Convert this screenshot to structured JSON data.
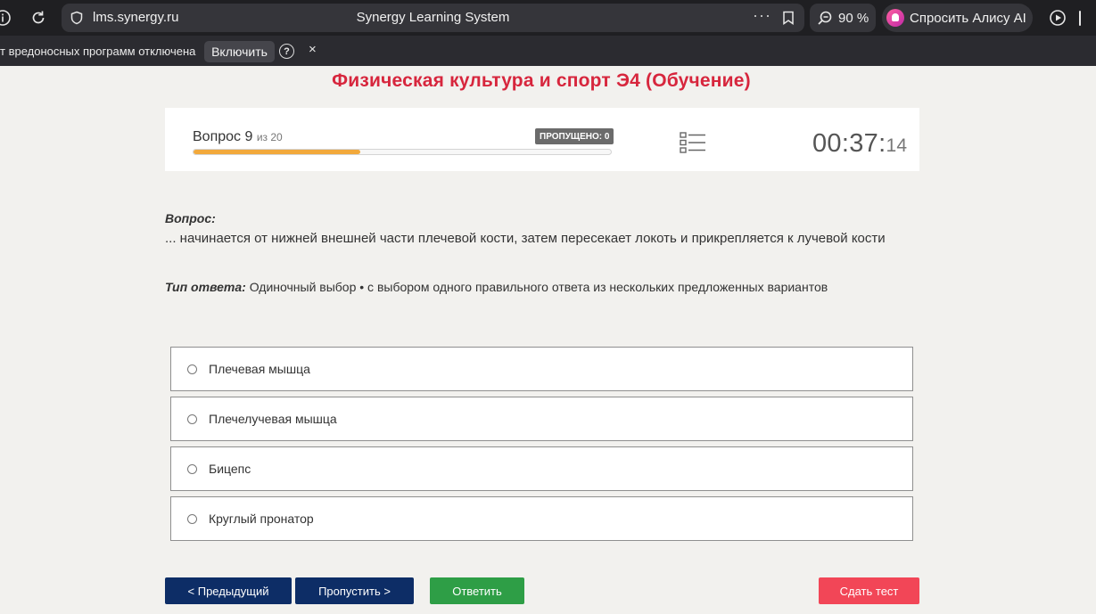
{
  "browser": {
    "url": "lms.synergy.ru",
    "page_title": "Synergy Learning System",
    "menu_dots": "···",
    "zoom": "90 %",
    "alice_label": "Спросить Алису AI"
  },
  "notification": {
    "message": "т вредоносных программ отключена",
    "enable_label": "Включить",
    "help": "?",
    "close": "×"
  },
  "test": {
    "title": "Физическая культура и спорт Э4 (Обучение)",
    "question_label": "Вопрос 9",
    "question_of": "из 20",
    "progress_fraction": 0.4,
    "skipped_badge": "ПРОПУЩЕНО: 0",
    "timer_main": "00:37:",
    "timer_seconds": "14"
  },
  "question": {
    "label": "Вопрос:",
    "text": "... начинается от нижней внешней части плечевой кости, затем пересекает локоть и прикрепляется к лучевой кости",
    "type_label": "Тип ответа:",
    "type_text": "Одиночный выбор • с выбором одного правильного ответа из нескольких предложенных вариантов"
  },
  "options": [
    "Плечевая мышца",
    "Плечелучевая мышца",
    "Бицепс",
    "Круглый пронатор"
  ],
  "buttons": {
    "prev": "< Предыдущий",
    "skip": "Пропустить >",
    "answer": "Ответить",
    "submit": "Сдать тест"
  },
  "colors": {
    "title_red": "#d7263d",
    "nav_blue": "#0d2d66",
    "answer_green": "#2e9e46",
    "submit_red": "#f24657",
    "progress_orange": "#f2a93b"
  }
}
